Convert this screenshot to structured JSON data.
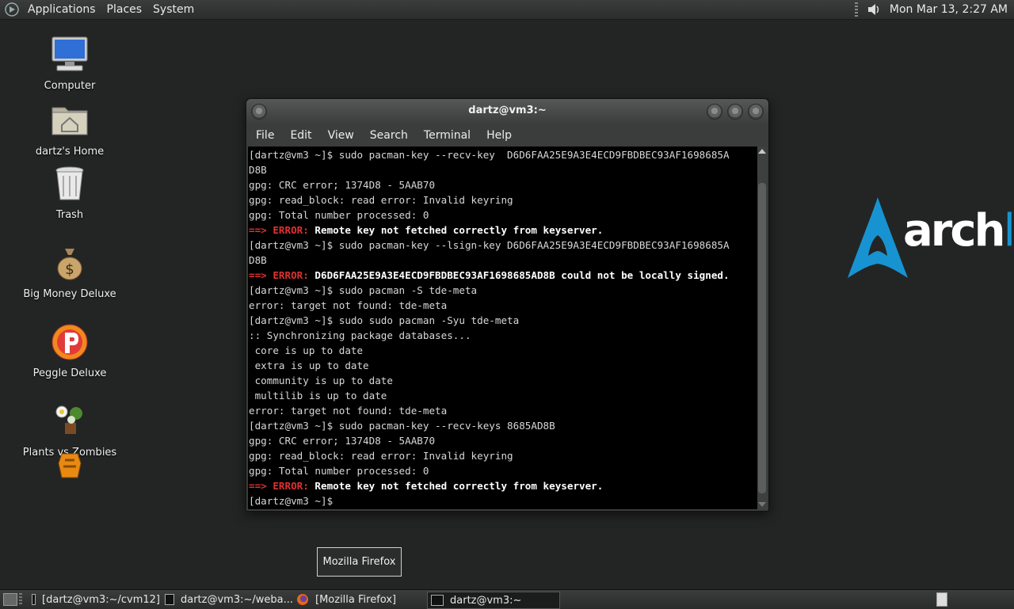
{
  "top_panel": {
    "menus": [
      "Applications",
      "Places",
      "System"
    ],
    "clock": "Mon Mar 13,  2:27 AM"
  },
  "desktop_icons": [
    {
      "label": "Computer",
      "icon": "computer-icon"
    },
    {
      "label": "dartz's Home",
      "icon": "home-folder-icon"
    },
    {
      "label": "Trash",
      "icon": "trash-icon"
    },
    {
      "label": "Big Money Deluxe",
      "icon": "money-bag-icon"
    },
    {
      "label": "Peggle Deluxe",
      "icon": "peggle-icon"
    },
    {
      "label": "Plants vs Zombies",
      "icon": "plants-vs-zombies-icon"
    }
  ],
  "wallpaper_logo": {
    "text_a": "arch",
    "text_b": "lin"
  },
  "terminal": {
    "title": "dartz@vm3:~",
    "menu": [
      "File",
      "Edit",
      "View",
      "Search",
      "Terminal",
      "Help"
    ],
    "lines": [
      {
        "text": "[dartz@vm3 ~]$ sudo pacman-key --recv-key  D6D6FAA25E9A3E4ECD9FBDBEC93AF1698685A"
      },
      {
        "text": "D8B"
      },
      {
        "text": "gpg: CRC error; 1374D8 - 5AAB70"
      },
      {
        "text": "gpg: read_block: read error: Invalid keyring"
      },
      {
        "text": "gpg: Total number processed: 0"
      },
      {
        "err": "==> ERROR:",
        "text": " Remote key not fetched correctly from keyserver."
      },
      {
        "text": "[dartz@vm3 ~]$ sudo pacman-key --lsign-key D6D6FAA25E9A3E4ECD9FBDBEC93AF1698685A"
      },
      {
        "text": "D8B"
      },
      {
        "err": "==> ERROR:",
        "text": " D6D6FAA25E9A3E4ECD9FBDBEC93AF1698685AD8B could not be locally signed."
      },
      {
        "text": "[dartz@vm3 ~]$ sudo pacman -S tde-meta"
      },
      {
        "text": "error: target not found: tde-meta"
      },
      {
        "text": "[dartz@vm3 ~]$ sudo sudo pacman -Syu tde-meta"
      },
      {
        "text": ":: Synchronizing package databases..."
      },
      {
        "text": " core is up to date"
      },
      {
        "text": " extra is up to date"
      },
      {
        "text": " community is up to date"
      },
      {
        "text": " multilib is up to date"
      },
      {
        "text": "error: target not found: tde-meta"
      },
      {
        "text": "[dartz@vm3 ~]$ sudo pacman-key --recv-keys 8685AD8B"
      },
      {
        "text": "gpg: CRC error; 1374D8 - 5AAB70"
      },
      {
        "text": "gpg: read_block: read error: Invalid keyring"
      },
      {
        "text": "gpg: Total number processed: 0"
      },
      {
        "err": "==> ERROR:",
        "text": " Remote key not fetched correctly from keyserver."
      },
      {
        "text": "[dartz@vm3 ~]$"
      }
    ]
  },
  "tooltip": "Mozilla Firefox",
  "taskbar": [
    {
      "label": "[dartz@vm3:~/cvm12]",
      "icon": "terminal-icon"
    },
    {
      "label": "dartz@vm3:~/weba...",
      "icon": "terminal-icon"
    },
    {
      "label": "[Mozilla Firefox]",
      "icon": "firefox-icon"
    },
    {
      "label": "dartz@vm3:~",
      "icon": "terminal-icon",
      "active": true
    }
  ],
  "colors": {
    "error_red": "#e03030",
    "arch_blue": "#1793d1",
    "desktop_bg": "#232524"
  }
}
